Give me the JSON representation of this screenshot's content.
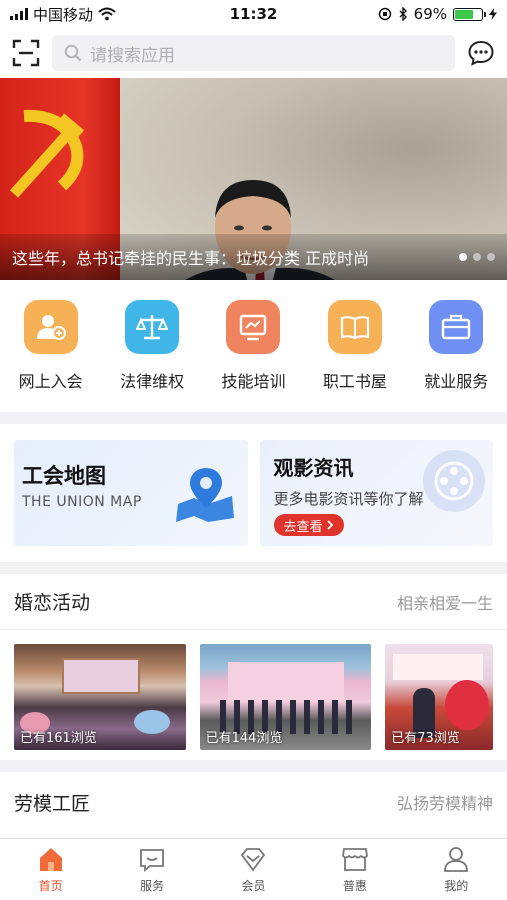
{
  "status": {
    "carrier": "中国移动",
    "time": "11:32",
    "battery": "69%",
    "battery_level": 0.69
  },
  "header": {
    "search_placeholder": "请搜索应用"
  },
  "banner": {
    "caption": "这些年，总书记牵挂的民生事：垃圾分类 正成时尚",
    "slides": 3,
    "active_slide": 0
  },
  "quick_entries": [
    {
      "label": "网上入会",
      "icon": "add-user-icon",
      "color": "#f6b056"
    },
    {
      "label": "法律维权",
      "icon": "scale-icon",
      "color": "#3fb5e8"
    },
    {
      "label": "技能培训",
      "icon": "board-icon",
      "color": "#f0845e"
    },
    {
      "label": "职工书屋",
      "icon": "book-icon",
      "color": "#f6b056"
    },
    {
      "label": "就业服务",
      "icon": "briefcase-icon",
      "color": "#6f8ff2"
    }
  ],
  "promo": {
    "map": {
      "title": "工会地图",
      "subtitle": "THE UNION MAP"
    },
    "film": {
      "title": "观影资讯",
      "subtitle": "更多电影资讯等你了解",
      "button": "去查看"
    }
  },
  "marriage": {
    "title": "婚恋活动",
    "more": "相亲相爱一生",
    "photos": [
      {
        "views": "已有161浏览"
      },
      {
        "views": "已有144浏览"
      },
      {
        "views": "已有73浏览"
      }
    ]
  },
  "model_worker": {
    "title": "劳模工匠",
    "more": "弘扬劳模精神"
  },
  "tabs": [
    {
      "label": "首页",
      "icon": "home-icon",
      "active": true
    },
    {
      "label": "服务",
      "icon": "service-icon",
      "active": false
    },
    {
      "label": "会员",
      "icon": "member-icon",
      "active": false
    },
    {
      "label": "普惠",
      "icon": "shop-icon",
      "active": false
    },
    {
      "label": "我的",
      "icon": "profile-icon",
      "active": false
    }
  ],
  "colors": {
    "accent": "#e8502a",
    "red_button": "#e0332b"
  }
}
